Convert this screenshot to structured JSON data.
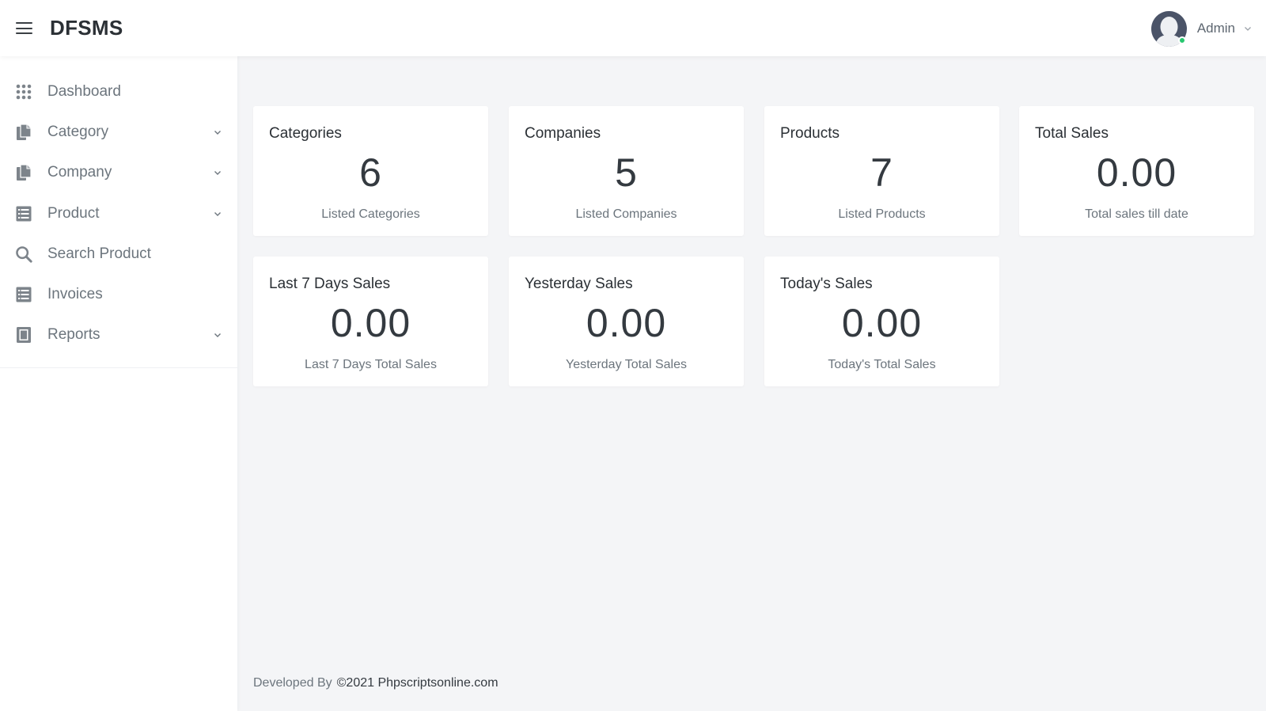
{
  "header": {
    "brand": "DFSMS",
    "user": {
      "name": "Admin",
      "status_color": "#28c76f"
    }
  },
  "sidebar": {
    "items": [
      {
        "label": "Dashboard",
        "icon": "grid-icon",
        "has_submenu": false
      },
      {
        "label": "Category",
        "icon": "file-copy-icon",
        "has_submenu": true
      },
      {
        "label": "Company",
        "icon": "file-copy-icon",
        "has_submenu": true
      },
      {
        "label": "Product",
        "icon": "list-icon",
        "has_submenu": true
      },
      {
        "label": "Search Product",
        "icon": "search-icon",
        "has_submenu": false
      },
      {
        "label": "Invoices",
        "icon": "list-icon",
        "has_submenu": false
      },
      {
        "label": "Reports",
        "icon": "report-icon",
        "has_submenu": true
      }
    ]
  },
  "cards": [
    {
      "title": "Categories",
      "value": "6",
      "subtitle": "Listed Categories"
    },
    {
      "title": "Companies",
      "value": "5",
      "subtitle": "Listed Companies"
    },
    {
      "title": "Products",
      "value": "7",
      "subtitle": "Listed Products"
    },
    {
      "title": "Total Sales",
      "value": "0.00",
      "subtitle": "Total sales till date"
    },
    {
      "title": "Last 7 Days Sales",
      "value": "0.00",
      "subtitle": "Last 7 Days Total Sales"
    },
    {
      "title": "Yesterday Sales",
      "value": "0.00",
      "subtitle": "Yesterday Total Sales"
    },
    {
      "title": "Today's Sales",
      "value": "0.00",
      "subtitle": "Today's Total Sales"
    }
  ],
  "footer": {
    "developed_by": "Developed By",
    "credit": "©2021 Phpscriptsonline.com"
  }
}
